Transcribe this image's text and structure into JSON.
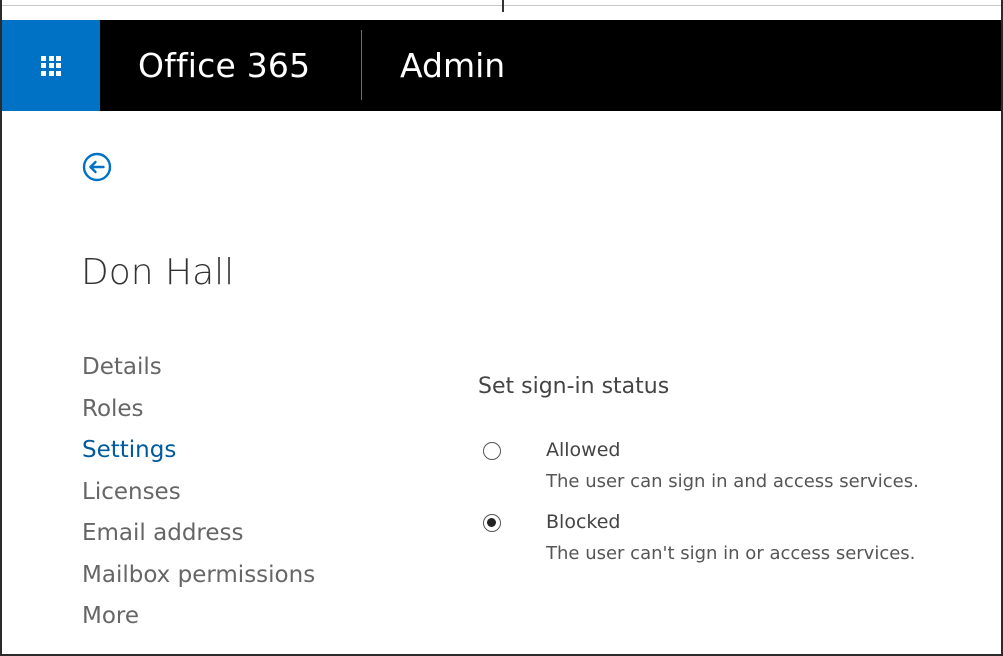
{
  "header": {
    "brand": "Office 365",
    "section": "Admin",
    "launcher_icon": "app-launcher-waffle-icon",
    "background": "#000000",
    "launcher_background": "#0072c6"
  },
  "back_button": {
    "icon": "back-arrow-circle-icon",
    "color": "#0072c6"
  },
  "user": {
    "name": "Don Hall"
  },
  "nav": {
    "items": [
      {
        "label": "Details"
      },
      {
        "label": "Roles"
      },
      {
        "label": "Settings",
        "active": true
      },
      {
        "label": "Licenses"
      },
      {
        "label": "Email address"
      },
      {
        "label": "Mailbox permissions"
      },
      {
        "label": "More"
      }
    ],
    "active_color": "#005a9e"
  },
  "sign_in": {
    "title": "Set sign-in status",
    "selected": "Blocked",
    "options": [
      {
        "label": "Allowed",
        "description": "The user can sign in and access services."
      },
      {
        "label": "Blocked",
        "description": "The user can't sign in or access services."
      }
    ]
  }
}
